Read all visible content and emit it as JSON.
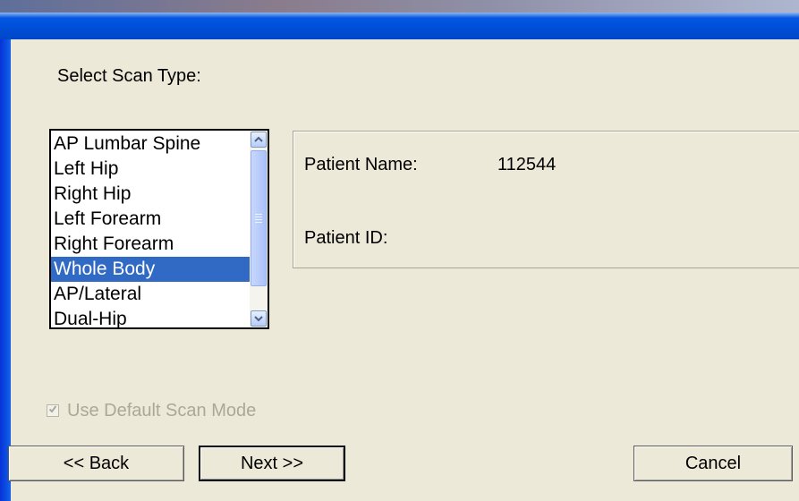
{
  "dialog": {
    "prompt": "Select Scan Type:"
  },
  "scan_types": {
    "items": [
      {
        "label": "AP Lumbar Spine",
        "selected": false
      },
      {
        "label": "Left Hip",
        "selected": false
      },
      {
        "label": "Right Hip",
        "selected": false
      },
      {
        "label": "Left Forearm",
        "selected": false
      },
      {
        "label": "Right Forearm",
        "selected": false
      },
      {
        "label": "Whole Body",
        "selected": true
      },
      {
        "label": "AP/Lateral",
        "selected": false
      },
      {
        "label": "Dual-Hip",
        "selected": false
      }
    ],
    "selected_value": "Whole Body"
  },
  "patient": {
    "name_label": "Patient Name:",
    "name_value": "112544",
    "id_label": "Patient ID:",
    "id_value": ""
  },
  "options": {
    "default_scan_mode_label": "Use Default Scan Mode",
    "default_scan_mode_checked": true,
    "default_scan_mode_enabled": false
  },
  "buttons": {
    "back_label": "<< Back",
    "next_label": "Next >>",
    "cancel_label": "Cancel"
  },
  "icons": {
    "scroll_up": "chevron-up-icon",
    "scroll_down": "chevron-down-icon",
    "checkbox": "check-icon"
  },
  "colors": {
    "selection": "#316ac5",
    "dialog_bg": "#ece9d8",
    "titlebar": "#0052dc",
    "disabled_text": "#aca899"
  }
}
